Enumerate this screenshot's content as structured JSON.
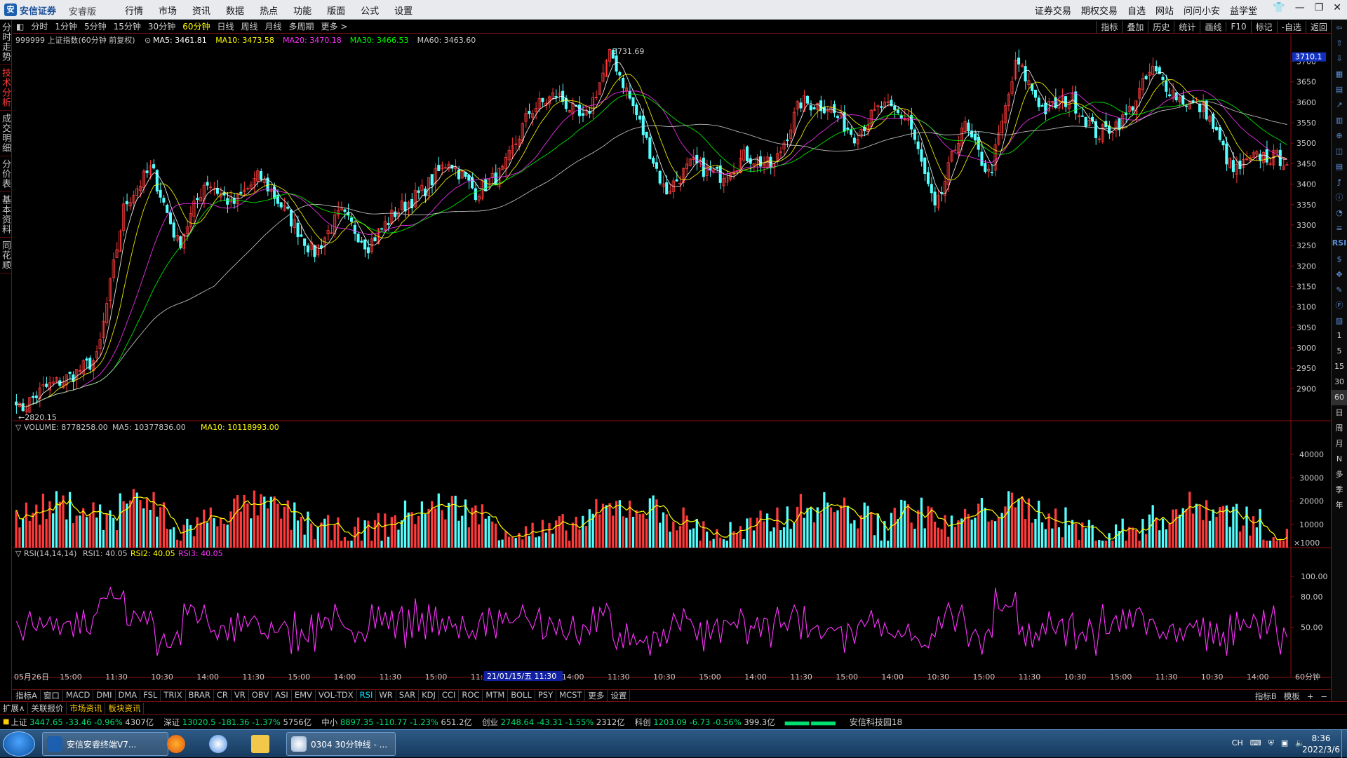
{
  "titlebar": {
    "logo_text": "安信证券",
    "edition": "安睿版",
    "menu": [
      "行情",
      "市场",
      "资讯",
      "数据",
      "热点",
      "功能",
      "版面",
      "公式",
      "设置"
    ],
    "right_menu": [
      "证券交易",
      "期权交易",
      "自选",
      "网站",
      "问问小安",
      "益学堂"
    ]
  },
  "left_tabs": [
    {
      "label": "分时走势",
      "active": false
    },
    {
      "label": "技术分析",
      "active": true
    },
    {
      "label": "成交明细",
      "active": false
    },
    {
      "label": "分价表",
      "active": false
    },
    {
      "label": "基本资料",
      "active": false
    },
    {
      "label": "同花顺",
      "active": false
    }
  ],
  "period_bar": {
    "periods": [
      "分时",
      "1分钟",
      "5分钟",
      "15分钟",
      "30分钟",
      "60分钟",
      "日线",
      "周线",
      "月线",
      "多周期",
      "更多 >"
    ],
    "active": "60分钟",
    "tools": [
      "指标",
      "叠加",
      "历史",
      "统计",
      "画线",
      "F10",
      "标记",
      "-自选",
      "返回"
    ]
  },
  "main_panel": {
    "title": "999999 上证指数(60分钟 前复权)",
    "ma_labels": [
      {
        "text": "MA5: 3461.81",
        "color": "#ffffff"
      },
      {
        "text": "MA10: 3473.58",
        "color": "#ffff00"
      },
      {
        "text": "MA20: 3470.18",
        "color": "#ff33ff"
      },
      {
        "text": "MA30: 3466.53",
        "color": "#00ff00"
      },
      {
        "text": "MA60: 3463.60",
        "color": "#cccccc"
      }
    ],
    "current_price_tag": "3710.1",
    "max_label": "3731.69",
    "min_label": "2820.15"
  },
  "volume_panel": {
    "title": "VOLUME: 8778258.00",
    "ma5": "MA5: 10377836.00",
    "ma10": "MA10: 10118993.00",
    "unit_label": "×1000"
  },
  "rsi_panel": {
    "title": "RSI(14,14,14)",
    "rsi1": "RSI1: 40.05",
    "rsi2": "RSI2: 40.05",
    "rsi3": "RSI3: 40.05"
  },
  "time_axis": {
    "labels": [
      "05月26日",
      "15:00",
      "11:30",
      "10:30",
      "14:00",
      "11:30",
      "15:00",
      "14:00",
      "11:30",
      "15:00",
      "11:30",
      "15:00",
      "14:00",
      "11:30",
      "10:30",
      "15:00",
      "14:00",
      "11:30",
      "15:00",
      "14:00",
      "10:30",
      "15:00",
      "11:30",
      "10:30",
      "15:00",
      "11:30",
      "10:30",
      "14:00"
    ],
    "highlight": "21/01/15/五 11:30",
    "period_label": "60分钟"
  },
  "indicator_bar": {
    "left": [
      "指标A",
      "窗口",
      "MACD",
      "DMI",
      "DMA",
      "FSL",
      "TRIX",
      "BRAR",
      "CR",
      "VR",
      "OBV",
      "ASI",
      "EMV",
      "VOL-TDX",
      "RSI",
      "WR",
      "SAR",
      "KDJ",
      "CCI",
      "ROC",
      "MTM",
      "BOLL",
      "PSY",
      "MCST",
      "更多",
      "设置"
    ],
    "active": "RSI",
    "right": [
      "指标B",
      "模板",
      "+",
      "−"
    ]
  },
  "ext_bar": [
    {
      "label": "扩展∧",
      "hl": false
    },
    {
      "label": "关联报价",
      "hl": false
    },
    {
      "label": "市场资讯",
      "hl": true
    },
    {
      "label": "板块资讯",
      "hl": true
    }
  ],
  "ticker": [
    {
      "name": "上证",
      "price": "3447.65",
      "chg": "-33.46",
      "pct": "-0.96%",
      "vol": "4307亿"
    },
    {
      "name": "深证",
      "price": "13020.5",
      "chg": "-181.36",
      "pct": "-1.37%",
      "vol": "5756亿"
    },
    {
      "name": "中小",
      "price": "8897.35",
      "chg": "-110.77",
      "pct": "-1.23%",
      "vol": "651.2亿"
    },
    {
      "name": "创业",
      "price": "2748.64",
      "chg": "-43.31",
      "pct": "-1.55%",
      "vol": "2312亿"
    },
    {
      "name": "科创",
      "price": "1203.09",
      "chg": "-6.73",
      "pct": "-0.56%",
      "vol": "399.3亿"
    }
  ],
  "ticker_news": "安信科技园18",
  "taskbar": {
    "windows": [
      "安信安睿终端V7...",
      "0304 30分钟线 - ..."
    ],
    "tray_lang": "CH",
    "time": "8:36",
    "date": "2022/3/6"
  },
  "right_toolbar_labels": [
    "RSI",
    "1",
    "5",
    "15",
    "30",
    "60",
    "日",
    "周",
    "月",
    "N",
    "多",
    "季",
    "年"
  ],
  "chart_data": [
    {
      "type": "candlestick",
      "title": "999999 上证指数(60分钟 前复权)",
      "ylim": [
        2820.15,
        3731.69
      ],
      "yticks": [
        2900,
        2950,
        3000,
        3050,
        3100,
        3150,
        3200,
        3250,
        3300,
        3350,
        3400,
        3450,
        3500,
        3550,
        3600,
        3650,
        3700
      ],
      "anchors_close": [
        2840,
        2900,
        2930,
        2975,
        3350,
        3440,
        3250,
        3410,
        3350,
        3420,
        3330,
        3230,
        3330,
        3250,
        3330,
        3380,
        3460,
        3380,
        3430,
        3580,
        3620,
        3550,
        3720,
        3560,
        3380,
        3450,
        3420,
        3470,
        3440,
        3600,
        3590,
        3520,
        3590,
        3560,
        3330,
        3550,
        3420,
        3700,
        3580,
        3610,
        3520,
        3560,
        3680,
        3610,
        3580,
        3430,
        3470,
        3460
      ],
      "series": [
        {
          "name": "MA5",
          "color": "#ffffff"
        },
        {
          "name": "MA10",
          "color": "#ffff00"
        },
        {
          "name": "MA20",
          "color": "#ff33ff"
        },
        {
          "name": "MA30",
          "color": "#00ff00"
        },
        {
          "name": "MA60",
          "color": "#cccccc"
        }
      ],
      "grid": false
    },
    {
      "type": "bar",
      "title": "VOLUME",
      "ylim": [
        0,
        40000
      ],
      "yticks": [
        10000,
        20000,
        30000,
        40000
      ],
      "unit": "×1000",
      "ma_series": [
        {
          "name": "MA5",
          "color": "#ffff00"
        },
        {
          "name": "MA10",
          "color": "#ffff00"
        }
      ]
    },
    {
      "type": "line",
      "title": "RSI(14,14,14)",
      "ylim": [
        0,
        100
      ],
      "yticks": [
        50.0,
        80.0,
        100.0
      ],
      "series": [
        {
          "name": "RSI1",
          "color": "#ff33ff",
          "last": 40.05
        }
      ]
    }
  ]
}
